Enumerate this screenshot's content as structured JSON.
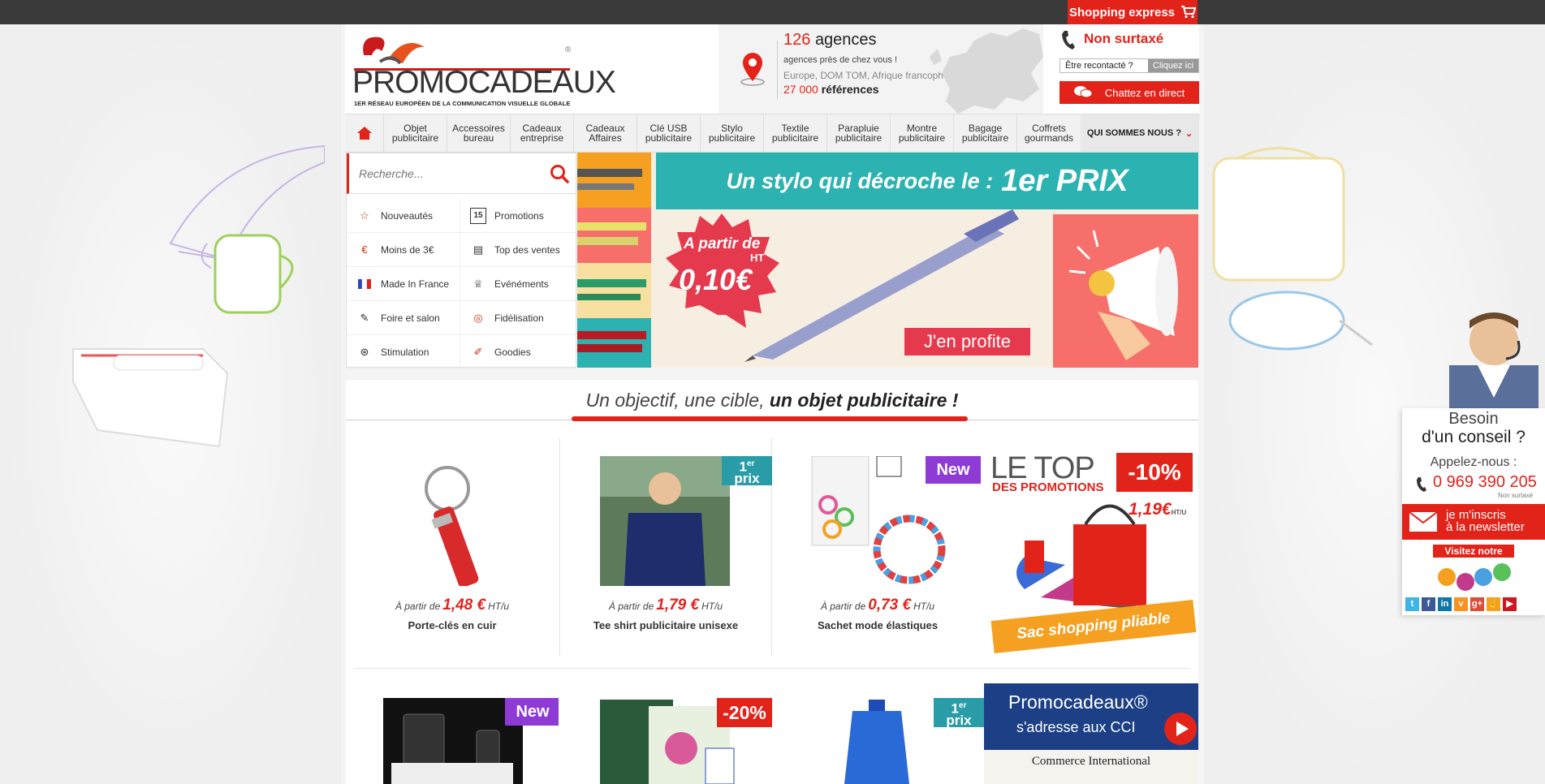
{
  "topbar": {
    "shopping_express": "Shopping express"
  },
  "header": {
    "logo_name_part1": "PROMO",
    "logo_name_part2": "CADEAUX",
    "logo_reg": "®",
    "logo_tagline": "1ER RÉSEAU EUROPÉEN DE LA COMMUNICATION VISUELLE GLOBALE",
    "agencies_count": "126",
    "agencies_word": "agences",
    "agencies_sub": "agences près de chez vous !",
    "regions": "Europe, DOM TOM, Afrique francophone",
    "references_count": "27 000",
    "references_word": "références",
    "non_surtaxe": "Non surtaxé",
    "recontact_label": "Être recontacté ?",
    "recontact_link": "Cliquez ici",
    "chat_label": "Chattez en direct"
  },
  "nav": {
    "items": [
      [
        "Objet",
        "publicitaire"
      ],
      [
        "Accessoires",
        "bureau"
      ],
      [
        "Cadeaux",
        "entreprise"
      ],
      [
        "Cadeaux",
        "Affaires"
      ],
      [
        "Clé USB",
        "publicitaire"
      ],
      [
        "Stylo",
        "publicitaire"
      ],
      [
        "Textile",
        "publicitaire"
      ],
      [
        "Parapluie",
        "publicitaire"
      ],
      [
        "Montre",
        "publicitaire"
      ],
      [
        "Bagage",
        "publicitaire"
      ],
      [
        "Coffrets",
        "gourmands"
      ]
    ],
    "who": "QUI SOMMES NOUS ?"
  },
  "search": {
    "placeholder": "Recherche..."
  },
  "menu": {
    "items": [
      {
        "label": "Nouveautés",
        "icon": "star-icon"
      },
      {
        "label": "Promotions",
        "icon": "calendar-15-icon"
      },
      {
        "label": "Moins de 3€",
        "icon": "euro-icon"
      },
      {
        "label": "Top des ventes",
        "icon": "ranking-icon"
      },
      {
        "label": "Made In France",
        "icon": "flag-france-icon"
      },
      {
        "label": "Evénéments",
        "icon": "trophy-icon"
      },
      {
        "label": "Foire et salon",
        "icon": "stamp-icon"
      },
      {
        "label": "Fidélisation",
        "icon": "ring-icon"
      },
      {
        "label": "Stimulation",
        "icon": "medal-icon"
      },
      {
        "label": "Goodies",
        "icon": "goodies-icon"
      }
    ]
  },
  "banner": {
    "title_part1": "Un stylo qui décroche le :",
    "title_part2": "1er PRIX",
    "from": "A partir de",
    "ht": "HT",
    "price": "0,10€",
    "cta": "J'en profite"
  },
  "section": {
    "title_part1": "Un objectif, une cible,",
    "title_part2": "un objet publicitaire !"
  },
  "products": {
    "price_prefix": "À partir de",
    "price_suffix": "HT/u",
    "items": [
      {
        "price": "1,48 €",
        "name": "Porte-clés en cuir"
      },
      {
        "price": "1,79 €",
        "name": "Tee shirt publicitaire unisexe",
        "badge_top": "1",
        "badge_sup": "er",
        "badge_bottom": "prix"
      },
      {
        "price": "0,73 €",
        "name": "Sachet mode élastiques",
        "badge": "New"
      }
    ]
  },
  "promo_box": {
    "line1": "LE TOP",
    "line2": "DES PROMOTIONS",
    "discount": "-10%",
    "price": "1,19€",
    "price_unit": "HT/U",
    "ribbon": "Sac shopping pliable"
  },
  "row2": {
    "badge1": "New",
    "badge2": "-20%",
    "badge3_top": "1",
    "badge3_sup": "er",
    "badge3_bottom": "prix"
  },
  "cci": {
    "line1": "Promocadeaux®",
    "line2": "s'adresse aux CCI",
    "paper": "Commerce International"
  },
  "side": {
    "besoin": "Besoin",
    "conseil": "d'un conseil ?",
    "appel": "Appelez-nous :",
    "tel": "0 969 390 205",
    "ns": "Non surtaxé",
    "news_line1": "je m'inscris",
    "news_line2": "à la newsletter",
    "blog_head": "Visitez notre",
    "social": [
      "twitter-icon",
      "facebook-icon",
      "linkedin-icon",
      "viadeo-icon",
      "googleplus-icon",
      "thumbsup-icon",
      "youtube-icon"
    ]
  },
  "colors": {
    "accent": "#e2231a",
    "teal": "#2cb2b0",
    "purple": "#8e3bd6",
    "orange": "#f5a020",
    "navy": "#1c3f86"
  }
}
